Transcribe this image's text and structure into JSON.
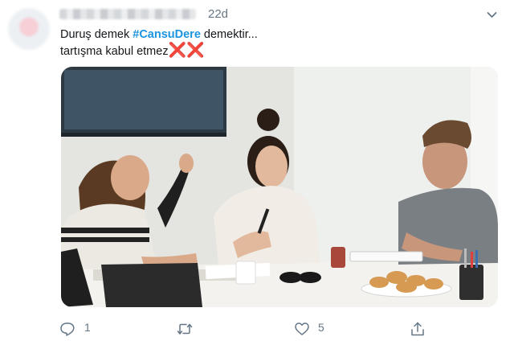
{
  "tweet": {
    "time": "22d",
    "line1_pre": "Duruş demek ",
    "hashtag": "#CansuDere",
    "line1_post": " demektir...",
    "line2": "tartışma kabul etmez",
    "emoji": "❌❌"
  },
  "photo": {
    "icon": "meeting-photo"
  },
  "actions": {
    "reply_count": "1",
    "retweet_count": "",
    "like_count": "5"
  },
  "colors": {
    "hashtag": "#1b95e0",
    "muted": "#657786",
    "cross": "#dd2e44"
  }
}
